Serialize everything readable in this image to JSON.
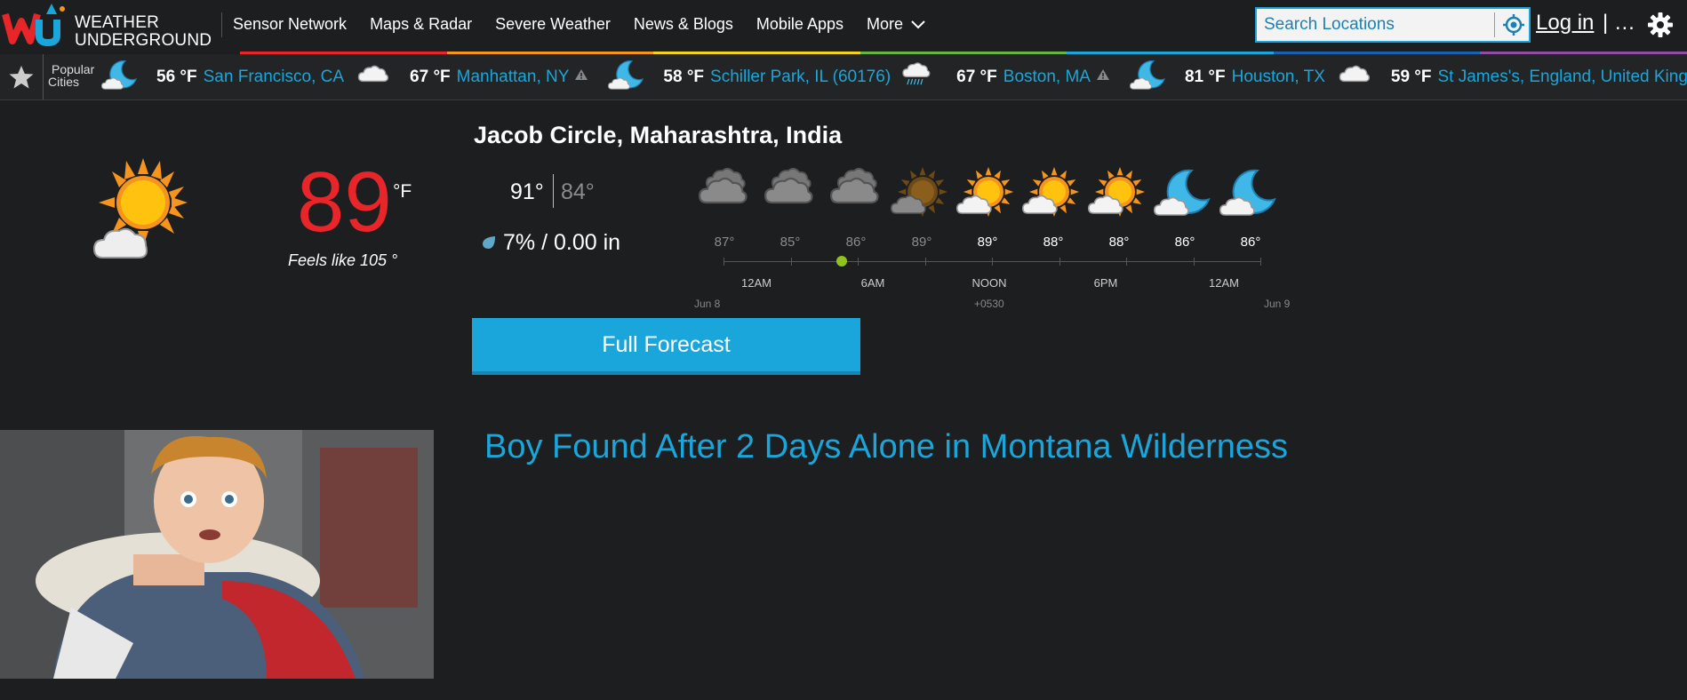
{
  "header": {
    "logo_line1": "WEATHER",
    "logo_line2": "UNDERGROUND",
    "nav": [
      "Sensor Network",
      "Maps & Radar",
      "Severe Weather",
      "News & Blogs",
      "Mobile Apps",
      "More"
    ],
    "search_placeholder": "Search Locations",
    "login_label": "Log in",
    "login_separator": "| …",
    "icons": [
      "locate-icon",
      "gear-icon",
      "chevron-down-icon"
    ]
  },
  "popular_cities": {
    "label_line1": "Popular",
    "label_line2": "Cities",
    "items": [
      {
        "temp": "56 °F",
        "name": "San Francisco, CA",
        "icon": "moon-cloud-icon",
        "alert": false
      },
      {
        "temp": "67 °F",
        "name": "Manhattan, NY",
        "icon": "cloud-icon",
        "alert": true
      },
      {
        "temp": "58 °F",
        "name": "Schiller Park, IL (60176)",
        "icon": "moon-cloud-icon",
        "alert": false
      },
      {
        "temp": "67 °F",
        "name": "Boston, MA",
        "icon": "rain-cloud-icon",
        "alert": true
      },
      {
        "temp": "81 °F",
        "name": "Houston, TX",
        "icon": "moon-cloud-icon",
        "alert": false
      },
      {
        "temp": "59 °F",
        "name": "St James's, England, United Kingdom",
        "icon": "cloud-icon",
        "alert": false
      }
    ]
  },
  "current": {
    "location": "Jacob Circle, Maharashtra, India",
    "temp": "89",
    "unit": "°F",
    "feels_like": "Feels like 105 °",
    "high": "91°",
    "low": "84°",
    "precip": "7% / 0.00 in",
    "icon": "partly-cloudy-sun-icon"
  },
  "hourly": {
    "temps": [
      "87°",
      "85°",
      "86°",
      "89°",
      "89°",
      "88°",
      "88°",
      "86°",
      "86°"
    ],
    "past_count": 4,
    "icons": [
      "cloud-icon",
      "cloud-icon",
      "cloud-icon",
      "sun-cloud-icon",
      "sun-cloud-icon",
      "sun-cloud-icon",
      "sun-cloud-icon",
      "moon-cloud-icon",
      "moon-cloud-icon"
    ],
    "time_labels": [
      "12AM",
      "6AM",
      "NOON",
      "6PM",
      "12AM"
    ],
    "date_start": "Jun 8",
    "timezone": "+0530",
    "date_end": "Jun 9"
  },
  "forecast_button": "Full Forecast",
  "news": {
    "headline": "Boy Found After 2 Days Alone in Montana Wilderness"
  },
  "colors": {
    "accent": "#1aa6da",
    "temp_red": "#e8262a",
    "background": "#1d1e20",
    "sun_orange": "#f7941d",
    "moon_blue": "#3fb8e8"
  }
}
